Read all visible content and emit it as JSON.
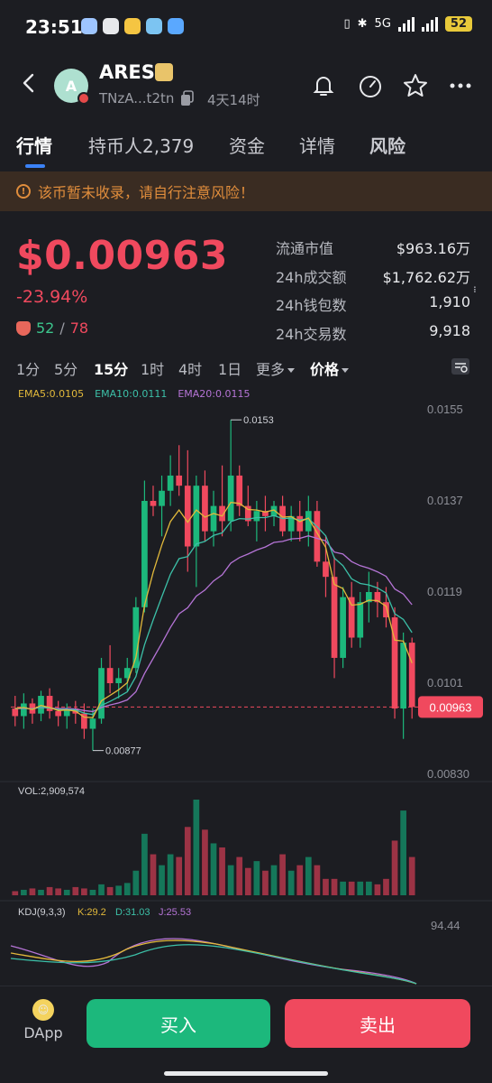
{
  "status": {
    "time": "23:51",
    "network": "5G",
    "battery": "52",
    "apps": [
      {
        "icon": "app-icon-1",
        "color": "#9ec5ff"
      },
      {
        "icon": "x-icon",
        "color": "#e8e9ec"
      },
      {
        "icon": "app-icon-3",
        "color": "#f5c542"
      },
      {
        "icon": "app-icon-4",
        "color": "#7cc4f2"
      },
      {
        "icon": "app-icon-5",
        "color": "#5aa8ff"
      }
    ]
  },
  "header": {
    "avatar_letter": "A",
    "coin_name": "ARES",
    "address": "TNzA...t2tn",
    "age": "4天14时"
  },
  "tabs": [
    {
      "label": "行情",
      "active": true
    },
    {
      "label": "持币人2,379"
    },
    {
      "label": "资金"
    },
    {
      "label": "详情"
    },
    {
      "label": "风险"
    }
  ],
  "warning": "该币暂未收录，请自行注意风险！",
  "price": {
    "value": "$0.00963",
    "change": "-23.94%",
    "holders_a": "52",
    "holders_sep": "/",
    "holders_b": "78"
  },
  "stats": [
    {
      "label": "流通市值",
      "value": "$963.16万"
    },
    {
      "label": "24h成交额",
      "value": "$1,762.62万"
    },
    {
      "label": "24h钱包数",
      "value": "1,910"
    },
    {
      "label": "24h交易数",
      "value": "9,918"
    }
  ],
  "timeframes": [
    {
      "label": "1分"
    },
    {
      "label": "5分"
    },
    {
      "label": "15分",
      "active": true
    },
    {
      "label": "1时"
    },
    {
      "label": "4时"
    },
    {
      "label": "1日"
    },
    {
      "label": "更多",
      "dropdown": true
    },
    {
      "label": "价格",
      "dropdown": true,
      "bold": true
    }
  ],
  "ema_legend": {
    "ema5": "EMA5:0.0105",
    "ema10": "EMA10:0.0111",
    "ema20": "EMA20:0.0115"
  },
  "chart_data": {
    "type": "candlestick",
    "y_axis_ticks": [
      "0.0155",
      "0.0137",
      "0.0119",
      "0.0101",
      "0.00830"
    ],
    "ylim": [
      0.0083,
      0.0155
    ],
    "current_price_label": "0.00963",
    "max_label": "0.0153",
    "min_label": "0.00877",
    "candles": [
      {
        "o": 0.0096,
        "h": 0.00985,
        "l": 0.00925,
        "c": 0.00945
      },
      {
        "o": 0.00945,
        "h": 0.0099,
        "l": 0.0092,
        "c": 0.0097
      },
      {
        "o": 0.0097,
        "h": 0.0098,
        "l": 0.0093,
        "c": 0.0095
      },
      {
        "o": 0.0095,
        "h": 0.00995,
        "l": 0.00935,
        "c": 0.00985
      },
      {
        "o": 0.00985,
        "h": 0.01,
        "l": 0.0094,
        "c": 0.00955
      },
      {
        "o": 0.00955,
        "h": 0.00975,
        "l": 0.00925,
        "c": 0.00945
      },
      {
        "o": 0.00945,
        "h": 0.0097,
        "l": 0.0092,
        "c": 0.0096
      },
      {
        "o": 0.0096,
        "h": 0.00975,
        "l": 0.0093,
        "c": 0.0095
      },
      {
        "o": 0.0095,
        "h": 0.0097,
        "l": 0.009,
        "c": 0.0092
      },
      {
        "o": 0.0092,
        "h": 0.0096,
        "l": 0.00877,
        "c": 0.0094
      },
      {
        "o": 0.0094,
        "h": 0.0106,
        "l": 0.0093,
        "c": 0.0104
      },
      {
        "o": 0.0104,
        "h": 0.01085,
        "l": 0.0099,
        "c": 0.0101
      },
      {
        "o": 0.0101,
        "h": 0.0104,
        "l": 0.0098,
        "c": 0.0102
      },
      {
        "o": 0.0102,
        "h": 0.0106,
        "l": 0.00995,
        "c": 0.0104
      },
      {
        "o": 0.0104,
        "h": 0.0118,
        "l": 0.0103,
        "c": 0.0116
      },
      {
        "o": 0.0116,
        "h": 0.0141,
        "l": 0.0115,
        "c": 0.0137
      },
      {
        "o": 0.0137,
        "h": 0.014,
        "l": 0.0134,
        "c": 0.0136
      },
      {
        "o": 0.0136,
        "h": 0.0142,
        "l": 0.013,
        "c": 0.0139
      },
      {
        "o": 0.0139,
        "h": 0.0146,
        "l": 0.0136,
        "c": 0.0142
      },
      {
        "o": 0.0142,
        "h": 0.0148,
        "l": 0.0138,
        "c": 0.014
      },
      {
        "o": 0.014,
        "h": 0.0147,
        "l": 0.0123,
        "c": 0.0128
      },
      {
        "o": 0.0128,
        "h": 0.0142,
        "l": 0.012,
        "c": 0.014
      },
      {
        "o": 0.014,
        "h": 0.0143,
        "l": 0.0129,
        "c": 0.0131
      },
      {
        "o": 0.0131,
        "h": 0.0139,
        "l": 0.0128,
        "c": 0.0136
      },
      {
        "o": 0.0136,
        "h": 0.0144,
        "l": 0.013,
        "c": 0.0133
      },
      {
        "o": 0.0133,
        "h": 0.0153,
        "l": 0.0131,
        "c": 0.0142
      },
      {
        "o": 0.0142,
        "h": 0.0144,
        "l": 0.0134,
        "c": 0.0136
      },
      {
        "o": 0.0136,
        "h": 0.014,
        "l": 0.0132,
        "c": 0.0133
      },
      {
        "o": 0.0133,
        "h": 0.0137,
        "l": 0.0129,
        "c": 0.0135
      },
      {
        "o": 0.0135,
        "h": 0.0138,
        "l": 0.0131,
        "c": 0.0134
      },
      {
        "o": 0.0134,
        "h": 0.0137,
        "l": 0.0132,
        "c": 0.0136
      },
      {
        "o": 0.0136,
        "h": 0.0138,
        "l": 0.013,
        "c": 0.0131
      },
      {
        "o": 0.0131,
        "h": 0.0136,
        "l": 0.0129,
        "c": 0.0134
      },
      {
        "o": 0.0134,
        "h": 0.0137,
        "l": 0.0129,
        "c": 0.0131
      },
      {
        "o": 0.0131,
        "h": 0.0138,
        "l": 0.0128,
        "c": 0.0135
      },
      {
        "o": 0.0135,
        "h": 0.0137,
        "l": 0.0124,
        "c": 0.0125
      },
      {
        "o": 0.0125,
        "h": 0.013,
        "l": 0.0118,
        "c": 0.0122
      },
      {
        "o": 0.0122,
        "h": 0.0126,
        "l": 0.0102,
        "c": 0.0106
      },
      {
        "o": 0.0106,
        "h": 0.012,
        "l": 0.0104,
        "c": 0.0118
      },
      {
        "o": 0.0118,
        "h": 0.0121,
        "l": 0.0108,
        "c": 0.011
      },
      {
        "o": 0.011,
        "h": 0.0119,
        "l": 0.0108,
        "c": 0.0117
      },
      {
        "o": 0.0117,
        "h": 0.0123,
        "l": 0.0113,
        "c": 0.0119
      },
      {
        "o": 0.0119,
        "h": 0.0121,
        "l": 0.0114,
        "c": 0.0117
      },
      {
        "o": 0.0117,
        "h": 0.012,
        "l": 0.0112,
        "c": 0.0114
      },
      {
        "o": 0.0114,
        "h": 0.0116,
        "l": 0.0094,
        "c": 0.0096
      },
      {
        "o": 0.0096,
        "h": 0.0111,
        "l": 0.009,
        "c": 0.0109
      },
      {
        "o": 0.0109,
        "h": 0.011,
        "l": 0.0094,
        "c": 0.00963
      }
    ],
    "ema5": [
      0.0096,
      0.00962,
      0.00958,
      0.00966,
      0.00962,
      0.00956,
      0.00957,
      0.00955,
      0.00943,
      0.00942,
      0.00975,
      0.00986,
      0.00997,
      0.01011,
      0.01061,
      0.01164,
      0.01229,
      0.01283,
      0.01329,
      0.01352,
      0.01328,
      0.01352,
      0.01338,
      0.01345,
      0.0134,
      0.01367,
      0.01365,
      0.01353,
      0.01352,
      0.01348,
      0.01352,
      0.01338,
      0.01339,
      0.01329,
      0.01336,
      0.01307,
      0.01278,
      0.01205,
      0.01197,
      0.01164,
      0.01166,
      0.01174,
      0.01173,
      0.01162,
      0.01095,
      0.01093,
      0.0105
    ],
    "ema10": [
      0.0096,
      0.00961,
      0.00959,
      0.00963,
      0.00961,
      0.00958,
      0.00958,
      0.00957,
      0.00951,
      0.00948,
      0.00966,
      0.00974,
      0.00983,
      0.00993,
      0.01023,
      0.01086,
      0.01135,
      0.01181,
      0.01225,
      0.01256,
      0.0126,
      0.01285,
      0.0129,
      0.01302,
      0.01307,
      0.01329,
      0.01335,
      0.01334,
      0.01337,
      0.01337,
      0.01341,
      0.01335,
      0.01336,
      0.01332,
      0.01335,
      0.01319,
      0.01301,
      0.01257,
      0.01242,
      0.01216,
      0.01207,
      0.01204,
      0.01198,
      0.01188,
      0.01147,
      0.01136,
      0.0111
    ],
    "ema20": [
      0.0096,
      0.0096,
      0.0096,
      0.00962,
      0.00961,
      0.0096,
      0.0096,
      0.00959,
      0.00956,
      0.00954,
      0.00962,
      0.00967,
      0.00971,
      0.00977,
      0.00993,
      0.01029,
      0.01059,
      0.01089,
      0.0112,
      0.01147,
      0.01159,
      0.01182,
      0.01194,
      0.01212,
      0.01224,
      0.01247,
      0.01258,
      0.01265,
      0.01273,
      0.01279,
      0.01288,
      0.0129,
      0.01295,
      0.01296,
      0.01301,
      0.01296,
      0.01291,
      0.01269,
      0.01265,
      0.0125,
      0.01242,
      0.01237,
      0.0123,
      0.01221,
      0.01196,
      0.01186,
      0.01165
    ],
    "volume_label": "VOL:2,909,574",
    "volume": [
      3,
      4,
      5,
      4,
      6,
      5,
      4,
      6,
      5,
      4,
      8,
      6,
      7,
      9,
      18,
      45,
      30,
      22,
      30,
      28,
      50,
      70,
      48,
      38,
      35,
      22,
      28,
      20,
      25,
      18,
      22,
      30,
      18,
      22,
      28,
      22,
      12,
      12,
      10,
      10,
      10,
      10,
      8,
      12,
      40,
      62,
      28
    ],
    "kdj": {
      "label": "KDJ(9,3,3)",
      "k": "K:29.2",
      "d": "D:31.03",
      "j": "J:25.53",
      "top_tick": "94.44"
    }
  },
  "bottom": {
    "dapp_label": "DApp",
    "buy_label": "买入",
    "sell_label": "卖出"
  }
}
